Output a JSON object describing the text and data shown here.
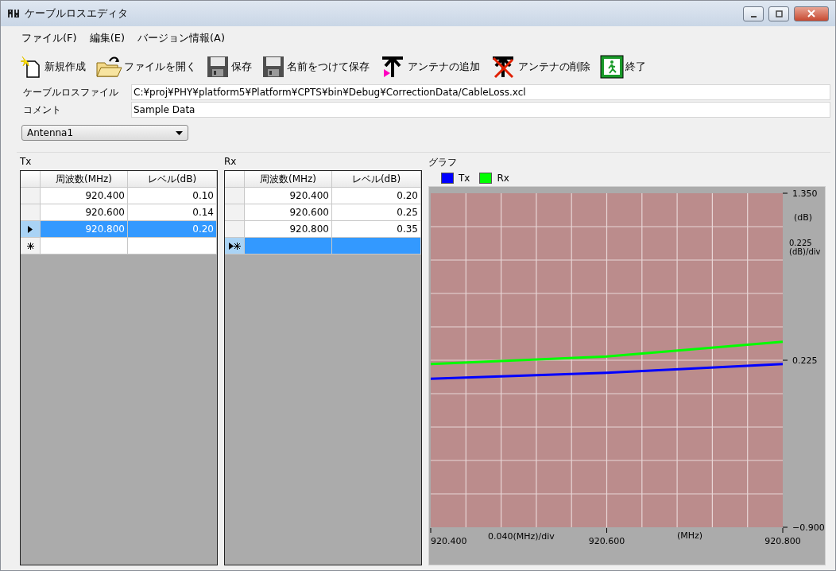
{
  "window": {
    "title": "ケーブルロスエディタ"
  },
  "menu": [
    {
      "label": "ファイル(F)"
    },
    {
      "label": "編集(E)"
    },
    {
      "label": "バージョン情報(A)"
    }
  ],
  "toolbar": [
    {
      "kind": "new",
      "label": "新規作成"
    },
    {
      "kind": "open",
      "label": "ファイルを開く"
    },
    {
      "kind": "save",
      "label": "保存"
    },
    {
      "kind": "save_as",
      "label": "名前をつけて保存"
    },
    {
      "kind": "add_antenna",
      "label": "アンテナの追加"
    },
    {
      "kind": "delete_antenna",
      "label": "アンテナの削除"
    },
    {
      "kind": "exit",
      "label": "終了"
    }
  ],
  "file": {
    "label": "ケーブルロスファイル",
    "value": "C:¥proj¥PHY¥platform5¥Platform¥CPTS¥bin¥Debug¥CorrectionData/CableLoss.xcl"
  },
  "comment": {
    "label": "コメント",
    "value": "Sample Data"
  },
  "antenna_select": {
    "value": "Antenna1"
  },
  "tables": [
    {
      "title": "Tx",
      "columns": [
        "周波数(MHz)",
        "レベル(dB)"
      ],
      "rows": [
        {
          "kind": "data",
          "cells": [
            "920.400",
            "0.10"
          ],
          "selected": false
        },
        {
          "kind": "data",
          "cells": [
            "920.600",
            "0.14"
          ],
          "selected": false
        },
        {
          "kind": "data",
          "cells": [
            "920.800",
            "0.20"
          ],
          "selected": true
        },
        {
          "kind": "new",
          "selected": false
        }
      ]
    },
    {
      "title": "Rx",
      "columns": [
        "周波数(MHz)",
        "レベル(dB)"
      ],
      "rows": [
        {
          "kind": "data",
          "cells": [
            "920.400",
            "0.20"
          ],
          "selected": false
        },
        {
          "kind": "data",
          "cells": [
            "920.600",
            "0.25"
          ],
          "selected": false
        },
        {
          "kind": "data",
          "cells": [
            "920.800",
            "0.35"
          ],
          "selected": false
        },
        {
          "kind": "new",
          "selected": true
        }
      ]
    }
  ],
  "graph": {
    "title": "グラフ",
    "y_unit": "(dB)",
    "y_div": [
      "0.225",
      "(dB)/div"
    ],
    "x_div": "0.040(MHz)/div",
    "x_unit": "(MHz)",
    "chart_data": {
      "type": "line",
      "x": [
        920.4,
        920.6,
        920.8
      ],
      "series": [
        {
          "name": "Tx",
          "color": "#0000ff",
          "values": [
            0.1,
            0.14,
            0.2
          ]
        },
        {
          "name": "Rx",
          "color": "#00ff00",
          "values": [
            0.2,
            0.25,
            0.35
          ]
        }
      ],
      "xlim": [
        920.4,
        920.8
      ],
      "ylim": [
        -0.9,
        1.35
      ],
      "xticks": [
        {
          "value": 920.4,
          "label": "920.400"
        },
        {
          "value": 920.6,
          "label": "920.600"
        },
        {
          "value": 920.8,
          "label": "920.800"
        }
      ],
      "yticks": [
        {
          "value": 1.35,
          "label": "1.350"
        },
        {
          "value": 0.225,
          "label": "0.225"
        },
        {
          "value": -0.9,
          "label": "−0.900"
        }
      ]
    }
  }
}
